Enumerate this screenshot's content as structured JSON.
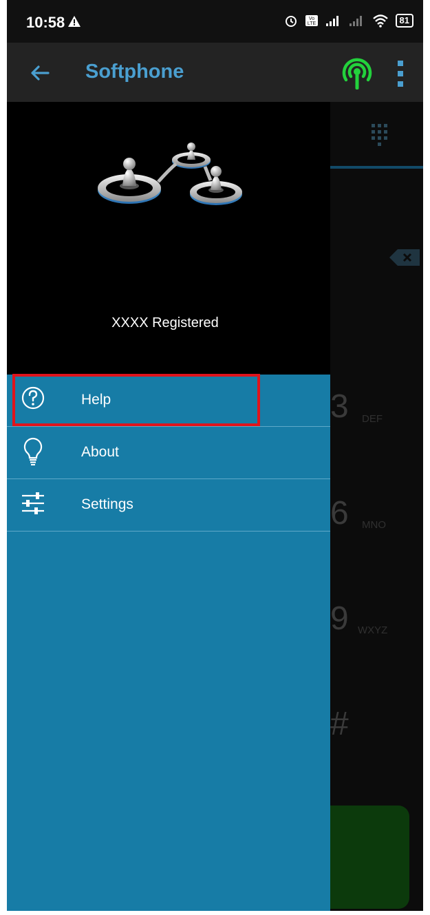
{
  "status_bar": {
    "time": "10:58",
    "battery": "81",
    "icons": [
      "warning-icon",
      "alarm-icon",
      "volte-icon",
      "cell-signal-icon",
      "wifi-icon",
      "battery-icon"
    ]
  },
  "app_bar": {
    "title": "Softphone",
    "title_color": "#4a9fd0"
  },
  "drawer": {
    "registration_status": "XXXX Registered",
    "items": [
      {
        "label": "Help",
        "icon": "help-icon"
      },
      {
        "label": "About",
        "icon": "lightbulb-icon"
      },
      {
        "label": "Settings",
        "icon": "sliders-icon"
      }
    ],
    "background_color": "#177ca6",
    "highlighted_item": "Settings"
  },
  "dialer": {
    "keys": [
      {
        "digit": "3",
        "letters": "DEF"
      },
      {
        "digit": "6",
        "letters": "MNO"
      },
      {
        "digit": "9",
        "letters": "WXYZ"
      },
      {
        "digit": "#",
        "letters": ""
      }
    ]
  }
}
